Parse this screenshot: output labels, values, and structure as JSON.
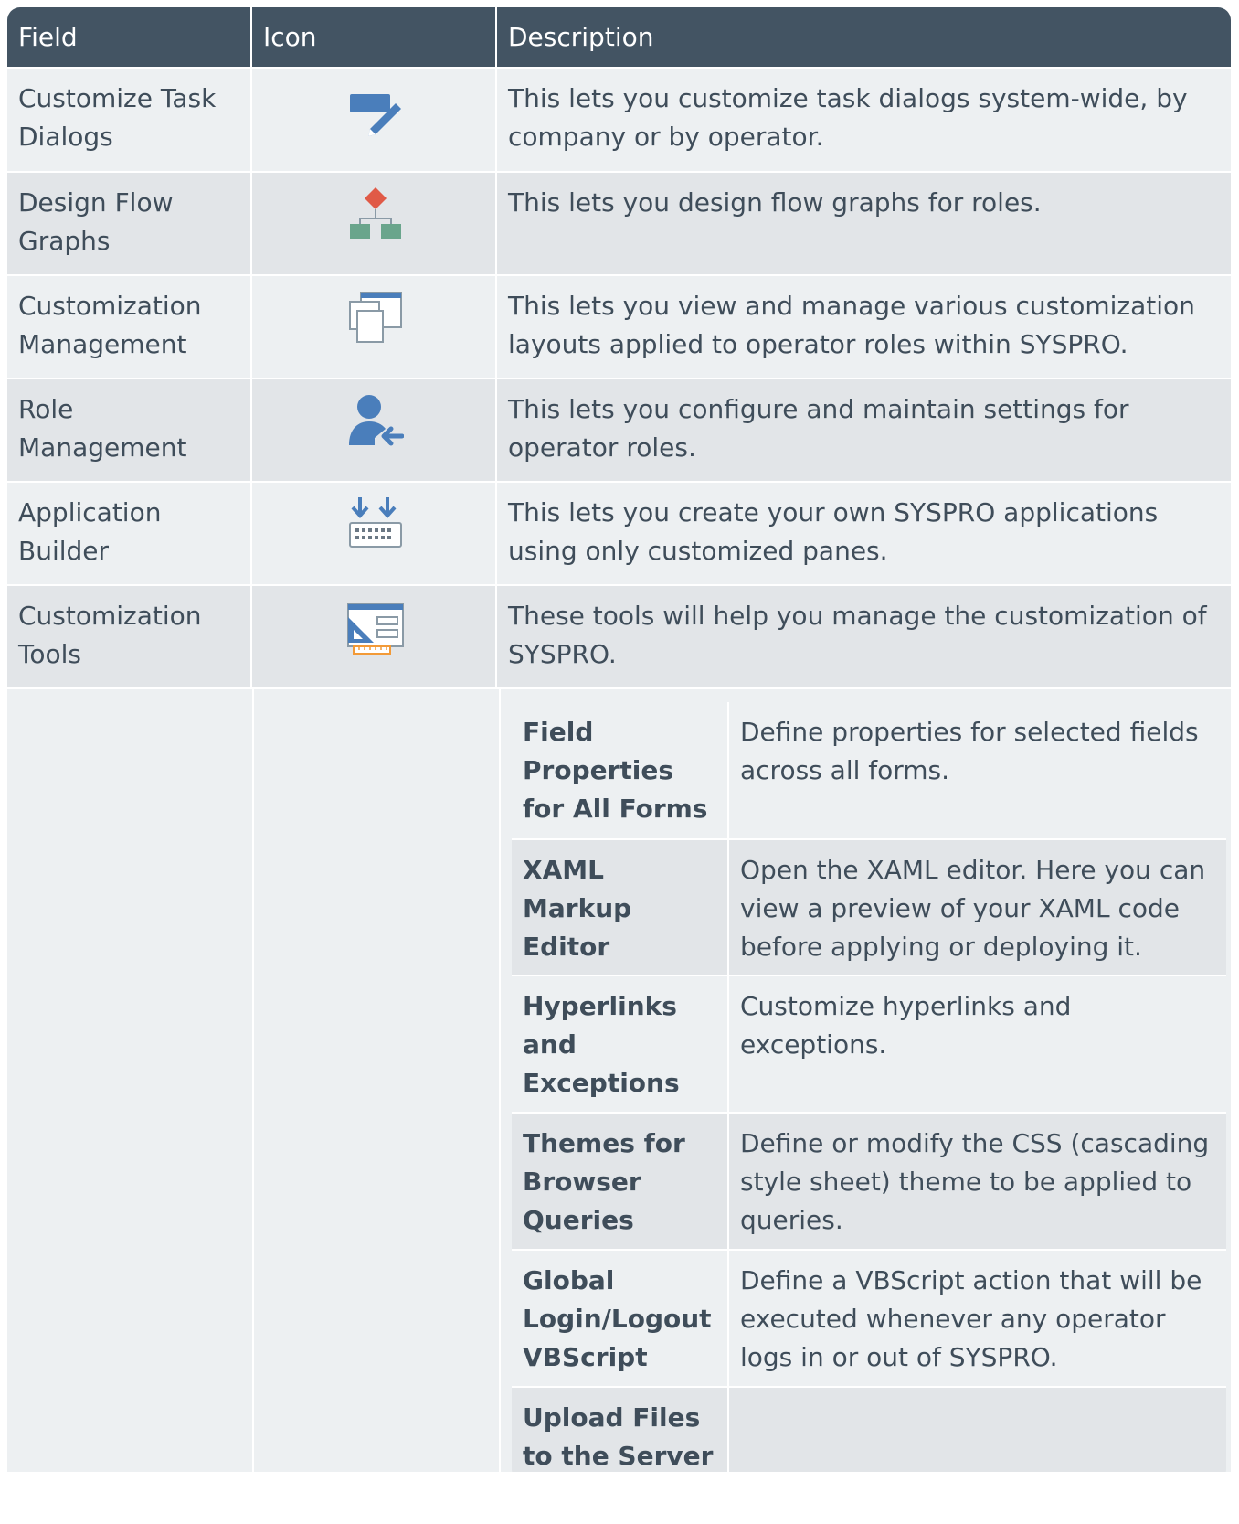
{
  "header": {
    "field": "Field",
    "icon": "Icon",
    "description": "Description"
  },
  "rows": [
    {
      "field": "Customize Task Dialogs",
      "icon": "customize-task-dialogs-icon",
      "description": "This lets you customize task dialogs system-wide, by company or by operator."
    },
    {
      "field": "Design Flow Graphs",
      "icon": "flow-graph-icon",
      "description": "This lets you design flow graphs for roles."
    },
    {
      "field": "Customization Management",
      "icon": "customization-management-icon",
      "description": "This lets you view and manage various customization layouts applied to operator roles within SYSPRO."
    },
    {
      "field": "Role Management",
      "icon": "role-management-icon",
      "description": "This lets you configure and maintain settings for operator roles."
    },
    {
      "field": "Application Builder",
      "icon": "application-builder-icon",
      "description": "This lets you create your own SYSPRO applications using only customized panes."
    },
    {
      "field": "Customization Tools",
      "icon": "customization-tools-icon",
      "description": "These tools will help you manage the customization of SYSPRO."
    }
  ],
  "tools": [
    {
      "name": "Field Properties for All Forms",
      "description": "Define properties for selected fields across all forms."
    },
    {
      "name": "XAML Markup Editor",
      "description": "Open the XAML editor. Here you can view a preview of your XAML code before applying or deploying it."
    },
    {
      "name": "Hyperlinks and Exceptions",
      "description": "Customize hyperlinks and exceptions."
    },
    {
      "name": "Themes for Browser Queries",
      "description": "Define or modify the CSS (cascading style sheet) theme to be applied to queries."
    },
    {
      "name": "Global Login/Logout VBScript",
      "description": "Define a VBScript action that will be executed whenever any operator logs in or out of SYSPRO."
    },
    {
      "name": "Upload Files to the Server",
      "description": ""
    }
  ],
  "colors": {
    "header_bg": "#435463",
    "row_light": "#edf0f2",
    "row_dark": "#e2e5e8",
    "text": "#3f4d5a",
    "icon_blue": "#4a7ebb",
    "icon_red": "#e05a47",
    "icon_green": "#6aa58c",
    "icon_orange": "#f29a38"
  }
}
